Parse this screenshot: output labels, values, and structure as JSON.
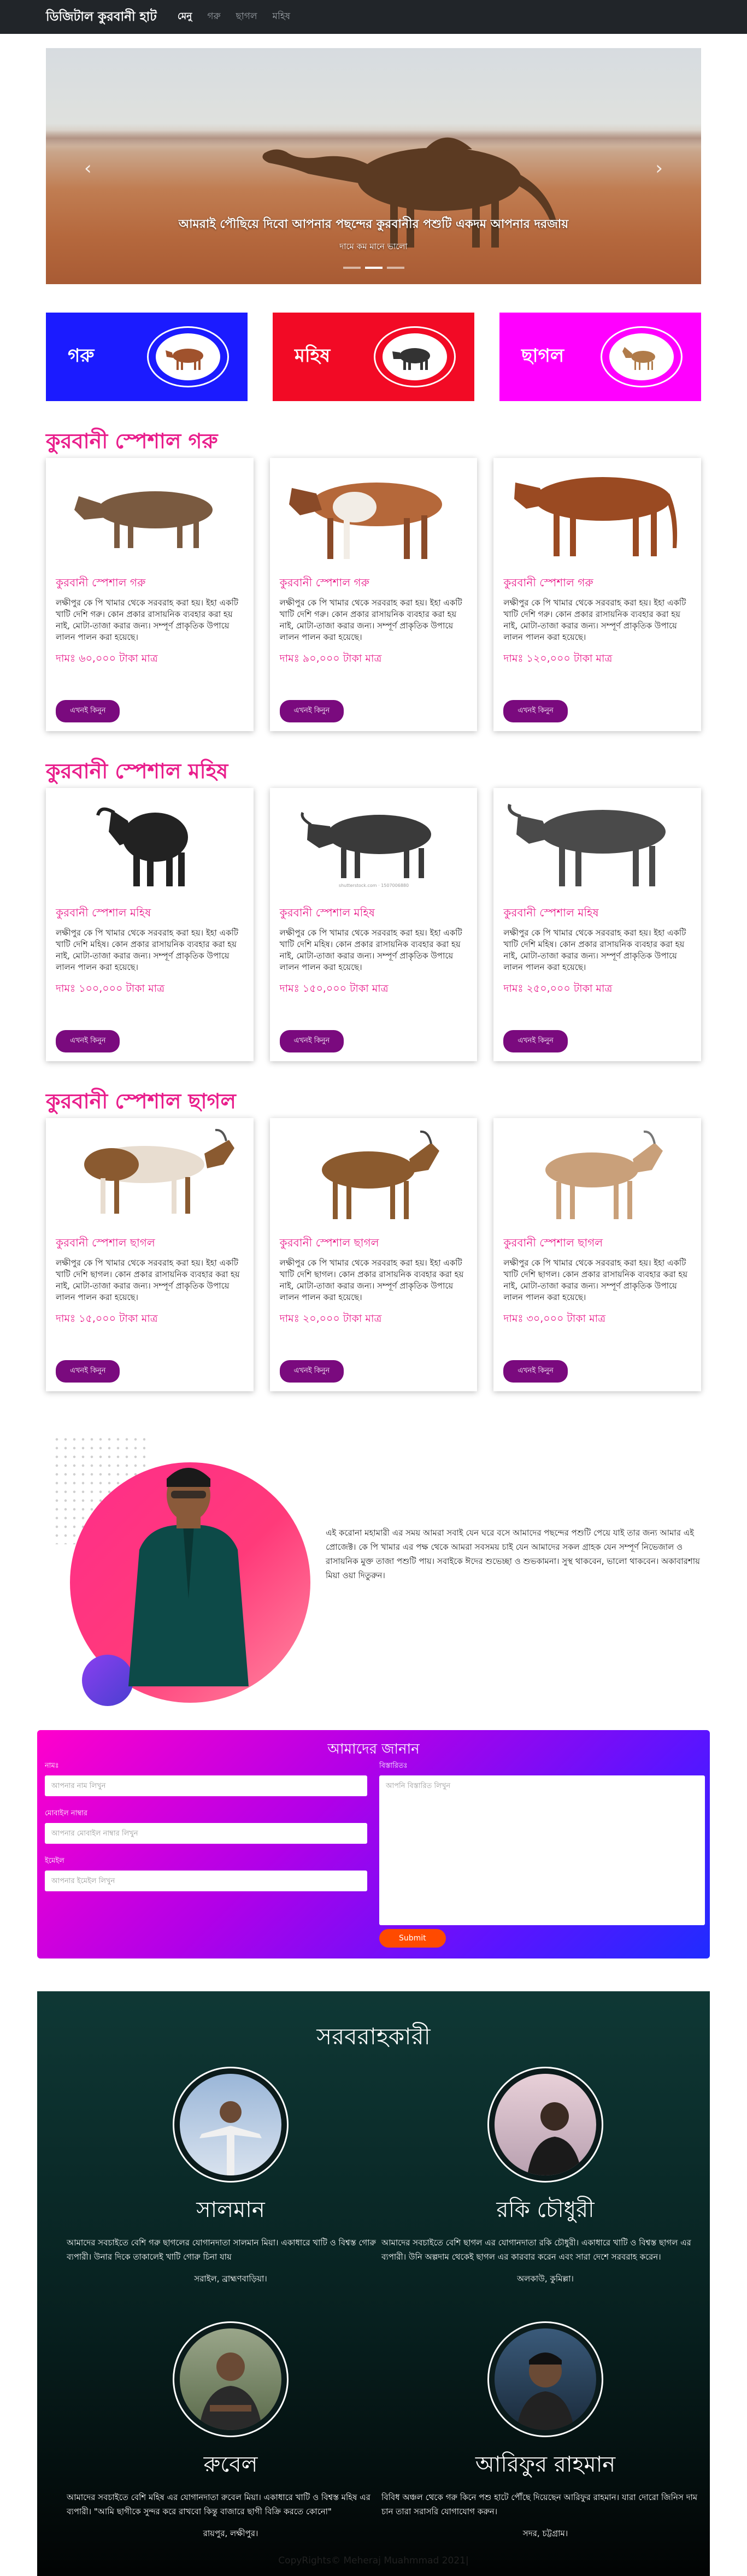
{
  "nav": {
    "brand": "ডিজিটাল কুরবানী হাট",
    "links": [
      "মেনু",
      "গরু",
      "ছাগল",
      "মহিষ"
    ]
  },
  "carousel": {
    "title": "আমরাই পৌছিয়ে দিবো আপনার পছন্দের কুরবানীর পশুটি একদম আপনার দরজায়",
    "subtitle": "দামে কম মানে ভালো"
  },
  "categories": [
    {
      "label": "গরু",
      "color": "#1b1bff"
    },
    {
      "label": "মহিষ",
      "color": "#f20a25"
    },
    {
      "label": "ছাগল",
      "color": "#ff00ff"
    }
  ],
  "sections": [
    {
      "title": "কুরবানী স্পেশাল গরু",
      "products": [
        {
          "name": "কুরবানী স্পেশাল গরু",
          "desc": "লক্ষীপুর কে পি খামার থেকে সরবরাহ করা হয়। ইহা একটি খাটি দেশি গরু। কোন প্রকার রাসায়নিক ব্যবহার করা হয় নাই, মোটা-তাজা করার জন্য। সম্পূর্ণ প্রাকৃতিক উপায়ে লালন পালন করা হয়েছে।",
          "price": "দামঃ ৬০,০০০ টাকা মাত্র",
          "buy": "এখনই কিনুন"
        },
        {
          "name": "কুরবানী স্পেশাল গরু",
          "desc": "লক্ষীপুর কে পি খামার থেকে সরবরাহ করা হয়। ইহা একটি খাটি দেশি গরু। কোন প্রকার রাসায়নিক ব্যবহার করা হয় নাই, মোটা-তাজা করার জন্য। সম্পূর্ণ প্রাকৃতিক উপায়ে লালন পালন করা হয়েছে।",
          "price": "দামঃ ৯০,০০০ টাকা মাত্র",
          "buy": "এখনই কিনুন"
        },
        {
          "name": "কুরবানী স্পেশাল গরু",
          "desc": "লক্ষীপুর কে পি খামার থেকে সরবরাহ করা হয়। ইহা একটি খাটি দেশি গরু। কোন প্রকার রাসায়নিক ব্যবহার করা হয় নাই, মোটা-তাজা করার জন্য। সম্পূর্ণ প্রাকৃতিক উপায়ে লালন পালন করা হয়েছে।",
          "price": "দামঃ ১২০,০০০ টাকা মাত্র",
          "buy": "এখনই কিনুন"
        }
      ]
    },
    {
      "title": "কুরবানী স্পেশাল মহিষ",
      "products": [
        {
          "name": "কুরবানী স্পেশাল মহিষ",
          "desc": "লক্ষীপুর কে পি খামার থেকে সরবরাহ করা হয়। ইহা একটি খাটি দেশি মহিষ। কোন প্রকার রাসায়নিক ব্যবহার করা হয় নাই, মোটা-তাজা করার জন্য। সম্পূর্ণ প্রাকৃতিক উপায়ে লালন পালন করা হয়েছে।",
          "price": "দামঃ ১০০,০০০ টাকা মাত্র",
          "buy": "এখনই কিনুন"
        },
        {
          "name": "কুরবানী স্পেশাল মহিষ",
          "desc": "লক্ষীপুর কে পি খামার থেকে সরবরাহ করা হয়। ইহা একটি খাটি দেশি মহিষ। কোন প্রকার রাসায়নিক ব্যবহার করা হয় নাই, মোটা-তাজা করার জন্য। সম্পূর্ণ প্রাকৃতিক উপায়ে লালন পালন করা হয়েছে।",
          "price": "দামঃ ১৫০,০০০ টাকা মাত্র",
          "buy": "এখনই কিনুন"
        },
        {
          "name": "কুরবানী স্পেশাল মহিষ",
          "desc": "লক্ষীপুর কে পি খামার থেকে সরবরাহ করা হয়। ইহা একটি খাটি দেশি মহিষ। কোন প্রকার রাসায়নিক ব্যবহার করা হয় নাই, মোটা-তাজা করার জন্য। সম্পূর্ণ প্রাকৃতিক উপায়ে লালন পালন করা হয়েছে।",
          "price": "দামঃ ২৫০,০০০ টাকা মাত্র",
          "buy": "এখনই কিনুন"
        }
      ]
    },
    {
      "title": "কুরবানী স্পেশাল ছাগল",
      "products": [
        {
          "name": "কুরবানী স্পেশাল ছাগল",
          "desc": "লক্ষীপুর কে পি খামার থেকে সরবরাহ করা হয়। ইহা একটি খাটি দেশি ছাগল। কোন প্রকার রাসায়নিক ব্যবহার করা হয় নাই, মোটা-তাজা করার জন্য। সম্পূর্ণ প্রাকৃতিক উপায়ে লালন পালন করা হয়েছে।",
          "price": "দামঃ ১৫,০০০ টাকা মাত্র",
          "buy": "এখনই কিনুন"
        },
        {
          "name": "কুরবানী স্পেশাল ছাগল",
          "desc": "লক্ষীপুর কে পি খামার থেকে সরবরাহ করা হয়। ইহা একটি খাটি দেশি ছাগল। কোন প্রকার রাসায়নিক ব্যবহার করা হয় নাই, মোটা-তাজা করার জন্য। সম্পূর্ণ প্রাকৃতিক উপায়ে লালন পালন করা হয়েছে।",
          "price": "দামঃ ২০,০০০ টাকা মাত্র",
          "buy": "এখনই কিনুন"
        },
        {
          "name": "কুরবানী স্পেশাল ছাগল",
          "desc": "লক্ষীপুর কে পি খামার থেকে সরবরাহ করা হয়। ইহা একটি খাটি দেশি ছাগল। কোন প্রকার রাসায়নিক ব্যবহার করা হয় নাই, মোটা-তাজা করার জন্য। সম্পূর্ণ প্রাকৃতিক উপায়ে লালন পালন করা হয়েছে।",
          "price": "দামঃ ৩০,০০০ টাকা মাত্র",
          "buy": "এখনই কিনুন"
        }
      ]
    }
  ],
  "about": {
    "text": "এই করোনা মহামারী এর সময় আমরা সবাই যেন ঘরে বসে আমাদের পছন্দের পশুটি পেয়ে যাই তার জন্য আমার এই প্রোজেক্ট। কে পি খামার এর পক্ষ থেকে আমরা সবসময় চাই যেন আমাদের সকল গ্রাহক যেন সম্পূর্ণ নিভেজাল ও রাসায়নিক মুক্ত তাজা পশুটি পায়। সবাইকে ঈদের শুভেচ্ছা ও শুভকামনা। সুস্থ থাকবেন, ভালো থাকবেন। অকাবারশায় মিয়া ওয়া দিতুরুন।"
  },
  "contact": {
    "title": "আমাদের জানান",
    "name_label": "নামঃ",
    "name_placeholder": "আপনার নাম লিখুন",
    "phone_label": "মোবাইল নাম্বার",
    "phone_placeholder": "আপনার মোবাইল নাম্বার লিখুন",
    "email_label": "ইমেইল",
    "email_placeholder": "আপনার ইমেইল লিখুন",
    "message_label": "বিস্তারিতঃ",
    "message_placeholder": "আপনি বিস্তারিত লিখুন",
    "submit": "Submit"
  },
  "suppliers": {
    "title": "সরবরাহকারী",
    "people": [
      {
        "name": "সালমান",
        "desc": "আমাদের সবচাইতে বেশি গরু ছাগলের যোগানদাতা সালমান মিয়া। একাধারে খাটি ও বিশ্বস্ত গোরু ব্যপারী। উনার দিকে তাকালেই খাটি গোরু চিনা যায়",
        "location": "সরাইল, ব্রাহ্মণবাড়িয়া।"
      },
      {
        "name": "রকি চৌধুরী",
        "desc": "আমাদের সবচাইতে বেশি ছাগল এর যোগানদাতা রকি চৌধুরী। একাধারে খাটি ও বিশ্বস্ত ছাগল এর ব্যপারী। উনি অল্পদাম থেকেই ছাগল এর কারবার করেন এবং সারা দেশে সরবরাহ করেন।",
        "location": "অলকাউ, কুমিল্লা।"
      },
      {
        "name": "রুবেল",
        "desc": "আমাদের সবচাইতে বেশি মহিষ এর যোগানদাতা রুবেল মিয়া। একাধারে খাটি ও বিশ্বস্ত মহিষ এর ব্যপারী। \"আমি ছাগীকে সুন্দর করে রাখবো কিন্তু বাজারে ছাগী বিক্রি করতে কোনো\"",
        "location": "রায়পুর, লক্ষীপুর।"
      },
      {
        "name": "আরিফুর রাহমান",
        "desc": "বিবিধ অঞ্চল থেকে গরু কিনে পশু হাটে পৌঁছে দিয়েছেন আরিফুর রাহমান। যারা দোরো জিনিস দাম চান তারা সরাসরি যোগাযোগ করুন।",
        "location": "সদর, চট্টগ্রাম।"
      }
    ]
  },
  "footer": "CopyRights© Meheraj Muahmmad 2021|"
}
